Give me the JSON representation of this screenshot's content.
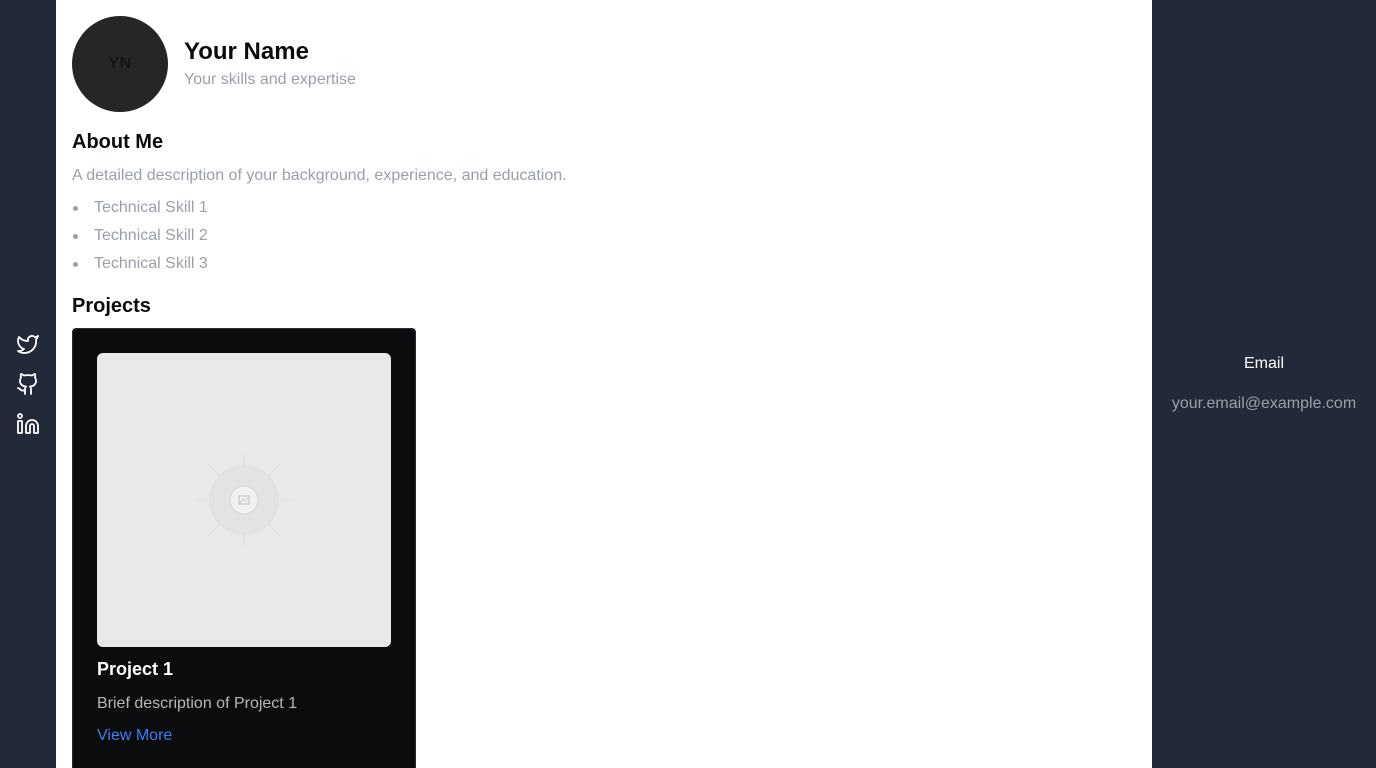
{
  "social": {
    "items": [
      {
        "icon": "twitter-icon",
        "label": "Twitter"
      },
      {
        "icon": "github-icon",
        "label": "GitHub"
      },
      {
        "icon": "linkedin-icon",
        "label": "LinkedIn"
      }
    ]
  },
  "profile": {
    "initials": "YN",
    "name": "Your Name",
    "tagline": "Your skills and expertise"
  },
  "about": {
    "heading": "About Me",
    "description": "A detailed description of your background, experience, and education.",
    "skills": [
      "Technical Skill 1",
      "Technical Skill 2",
      "Technical Skill 3"
    ]
  },
  "projects": {
    "heading": "Projects",
    "items": [
      {
        "image_icon": "image-placeholder-icon",
        "title": "Project 1",
        "description": "Brief description of Project 1",
        "link_label": "View More"
      }
    ]
  },
  "contact": {
    "label": "Email",
    "email": "your.email@example.com"
  },
  "colors": {
    "rail_bg": "#222938",
    "card_bg": "#0b0c0e",
    "link": "#3b82f6",
    "muted_text": "#9aa0a8"
  }
}
